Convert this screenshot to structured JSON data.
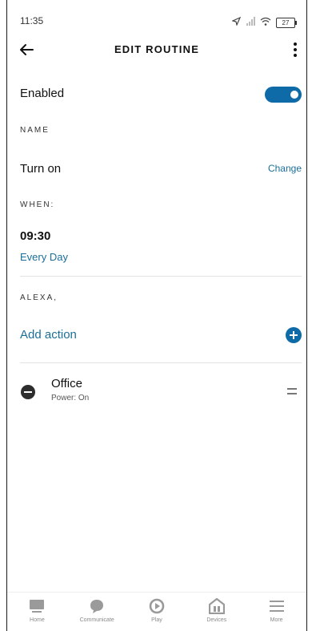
{
  "status_bar": {
    "time": "11:35",
    "battery": "27"
  },
  "header": {
    "title": "EDIT ROUTINE",
    "back_icon": "arrow-left-icon",
    "more_icon": "more-vertical-icon"
  },
  "enabled": {
    "label": "Enabled",
    "on": true
  },
  "name_section": {
    "label": "NAME",
    "value": "Turn on",
    "change_label": "Change"
  },
  "when_section": {
    "label": "WHEN:",
    "time": "09:30",
    "frequency": "Every Day"
  },
  "alexa_section": {
    "label": "ALEXA,",
    "add_action_label": "Add action"
  },
  "actions": [
    {
      "title": "Office",
      "subtitle": "Power: On"
    }
  ],
  "bottom_nav": [
    {
      "label": "Home",
      "icon": "home-icon"
    },
    {
      "label": "Communicate",
      "icon": "chat-icon"
    },
    {
      "label": "Play",
      "icon": "play-icon"
    },
    {
      "label": "Devices",
      "icon": "devices-icon"
    },
    {
      "label": "More",
      "icon": "menu-icon"
    }
  ],
  "colors": {
    "accent": "#0f6aa8",
    "link": "#1b6e99"
  }
}
